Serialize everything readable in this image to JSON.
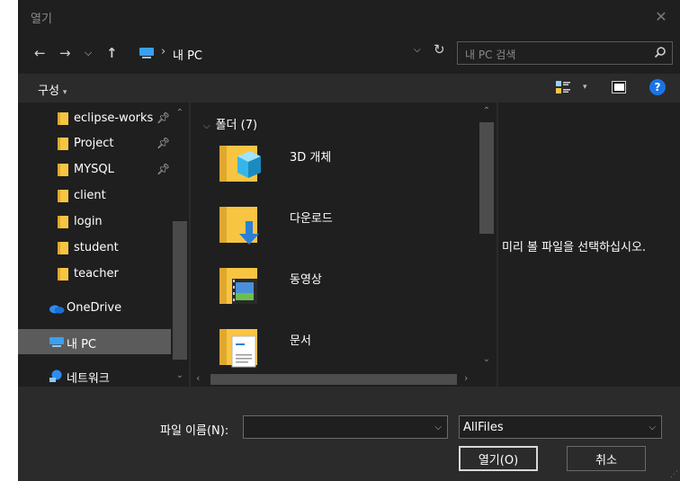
{
  "window": {
    "title": "열기"
  },
  "address": {
    "location": "내 PC"
  },
  "search": {
    "placeholder": "내 PC 검색"
  },
  "toolbar": {
    "organize_label": "구성"
  },
  "nav": {
    "items": [
      {
        "label": "eclipse-works",
        "pinned": true
      },
      {
        "label": "Project",
        "pinned": true
      },
      {
        "label": "MYSQL",
        "pinned": true
      },
      {
        "label": "client",
        "pinned": false
      },
      {
        "label": "login",
        "pinned": false
      },
      {
        "label": "student",
        "pinned": false
      },
      {
        "label": "teacher",
        "pinned": false
      },
      {
        "label": "OneDrive"
      },
      {
        "label": "내 PC",
        "selected": true
      },
      {
        "label": "네트워크"
      }
    ]
  },
  "files": {
    "group": "폴더 (7)",
    "items": [
      {
        "label": "3D 개체",
        "icon": "3d-objects-folder-icon"
      },
      {
        "label": "다운로드",
        "icon": "downloads-folder-icon"
      },
      {
        "label": "동영상",
        "icon": "videos-folder-icon"
      },
      {
        "label": "문서",
        "icon": "documents-folder-icon"
      }
    ]
  },
  "preview": {
    "message": "미리 볼 파일을 선택하십시오."
  },
  "bottom": {
    "filename_label": "파일 이름(N):",
    "filename_value": "",
    "filetype": "AllFiles",
    "open_label": "열기(O)",
    "cancel_label": "취소"
  },
  "colors": {
    "folder_yellow": "#f8c543",
    "accent_blue": "#1a73e8",
    "onedrive_blue": "#2e8bf0"
  }
}
